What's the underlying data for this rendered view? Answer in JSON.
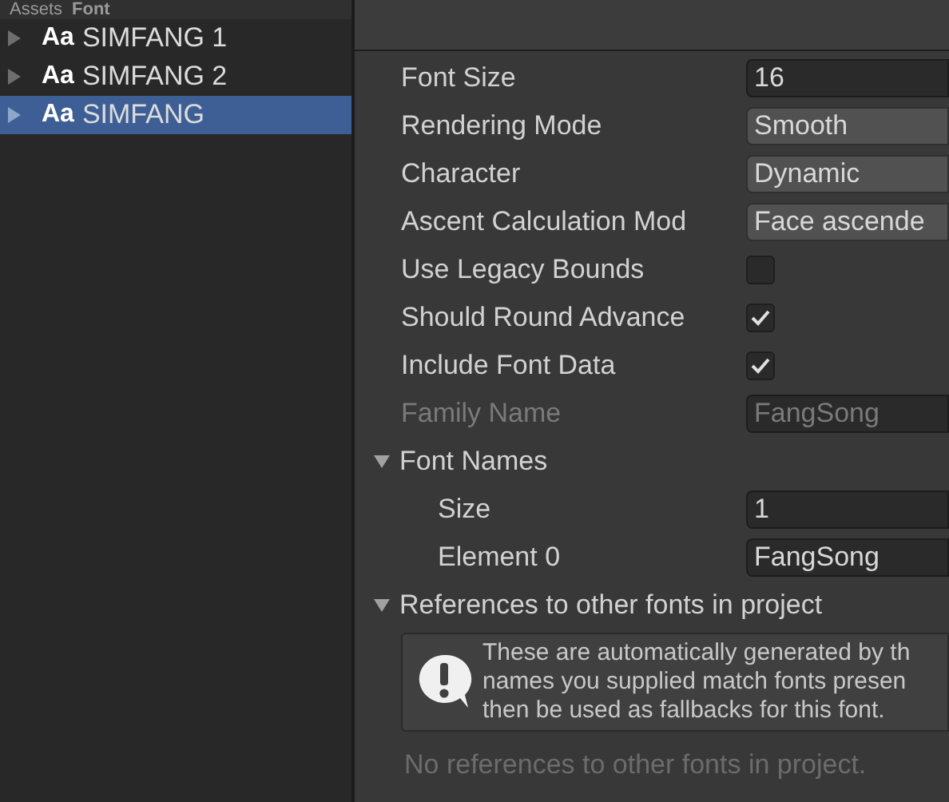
{
  "breadcrumb": [
    "Assets",
    "Font"
  ],
  "assets": [
    {
      "label": "SIMFANG 1",
      "badge": "Aa",
      "selected": false
    },
    {
      "label": "SIMFANG 2",
      "badge": "Aa",
      "selected": false
    },
    {
      "label": "SIMFANG",
      "badge": "Aa",
      "selected": true
    }
  ],
  "properties": [
    {
      "label": "Font Size",
      "kind": "field",
      "value": "16",
      "disabled": false
    },
    {
      "label": "Rendering Mode",
      "kind": "dropdown",
      "value": "Smooth",
      "disabled": false
    },
    {
      "label": "Character",
      "kind": "dropdown",
      "value": "Dynamic",
      "disabled": false
    },
    {
      "label": "Ascent Calculation Mod",
      "kind": "dropdown",
      "value": "Face ascende",
      "disabled": false
    },
    {
      "label": "Use Legacy Bounds",
      "kind": "checkbox",
      "checked": false,
      "disabled": false
    },
    {
      "label": "Should Round Advance",
      "kind": "checkbox",
      "checked": true,
      "disabled": false
    },
    {
      "label": "Include Font Data",
      "kind": "checkbox",
      "checked": true,
      "disabled": false
    },
    {
      "label": "Family Name",
      "kind": "field",
      "value": "FangSong",
      "disabled": true
    }
  ],
  "font_names": {
    "label": "Font Names",
    "expanded": true,
    "children": [
      {
        "label": "Size",
        "value": "1"
      },
      {
        "label": "Element 0",
        "value": "FangSong"
      }
    ]
  },
  "references": {
    "label": "References to other fonts in project",
    "expanded": true,
    "help_lines": [
      "These are automatically generated by th",
      "names you supplied match fonts presen",
      "then be used as fallbacks for this font."
    ],
    "empty_note": "No references to other fonts in project."
  }
}
